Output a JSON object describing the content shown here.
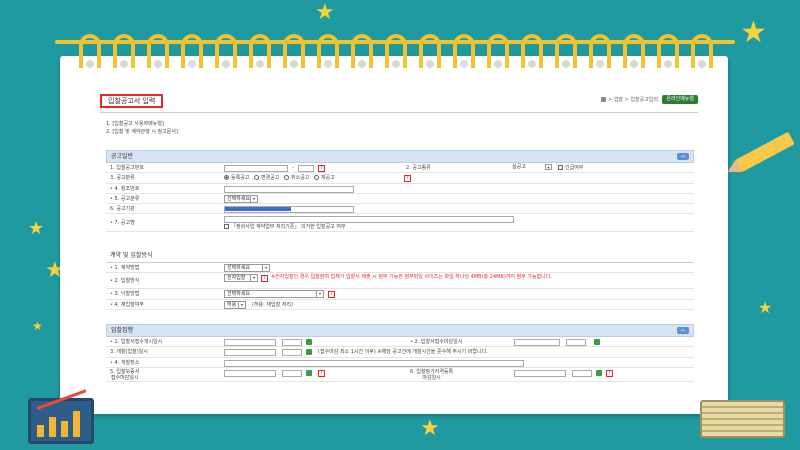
{
  "page": {
    "title": "입찰공고서 입력",
    "breadcrumb": "> 입찰 > 입찰공고입력",
    "help_button": "온라인매뉴얼",
    "notes": [
      "1. [입찰공고 사용자매뉴얼]",
      "2. [입찰 및 계약관행 시 참고문서]"
    ]
  },
  "colors": {
    "accent": "#e3262a",
    "section_bg": "#d5e3f3",
    "background": "#1e9aa0"
  },
  "sections": {
    "general": {
      "title": "공고일반",
      "rows": {
        "notice_no": "1. 입찰공고번호",
        "notice_no_sep": "-",
        "notice_type": "2. 공고종류",
        "notice_type_value": "실공고",
        "urgent_label": "긴급여부",
        "notice_class": "3. 공고분류",
        "radios": [
          "등록공고",
          "변경공고",
          "취소공고",
          "재공고"
        ],
        "ref_no": "4. 참조번호",
        "notice_category": "5. 공고분류",
        "notice_category_value": "선택하세요",
        "notice_agency": "6. 공고기관",
        "notice_name": "7. 공고명",
        "notice_name_check": "「정비사업 계약업무 처리기준」 의거한 입찰공고 여부"
      }
    },
    "contract": {
      "title": "계약 및 입찰방식",
      "rows": {
        "contract_method": "1. 계약방법",
        "contract_method_value": "선택하세요",
        "bid_method": "2. 입찰방식",
        "bid_method_value": "전자입찰",
        "bid_method_note": "※전자입찰인 경우 입찰참여 업체가 입찰서 제출 시 첨부 가능한 첨부파일 사이즈는 파일 하나당 4MB(총 24MB)까지 첨부 가능합니다.",
        "winner_method": "3. 낙찰방법",
        "winner_method_value": "선택하세요",
        "rebid": "4. 재입찰여부",
        "rebid_value": "허용",
        "rebid_note": "(허용: 재입찰 처리)"
      }
    },
    "schedule": {
      "title": "입찰집행",
      "rows": {
        "reg_start": "1. 입찰서접수개시일시",
        "reg_end": "2. 입찰서접수마감일시",
        "open_date": "3. 개찰(입찰)일시",
        "open_note": "(접수마감 최소 1시간 이후) ※해당 공고건에 개찰시간을 준수해 주시기 바랍니다.",
        "open_place": "4. 개찰장소",
        "qual_deadline": "5. 입찰보증서",
        "qual_deadline2": "접수마감일시",
        "price_deadline": "6. 입찰참가자격등록",
        "price_deadline2": "마감일시"
      }
    }
  }
}
